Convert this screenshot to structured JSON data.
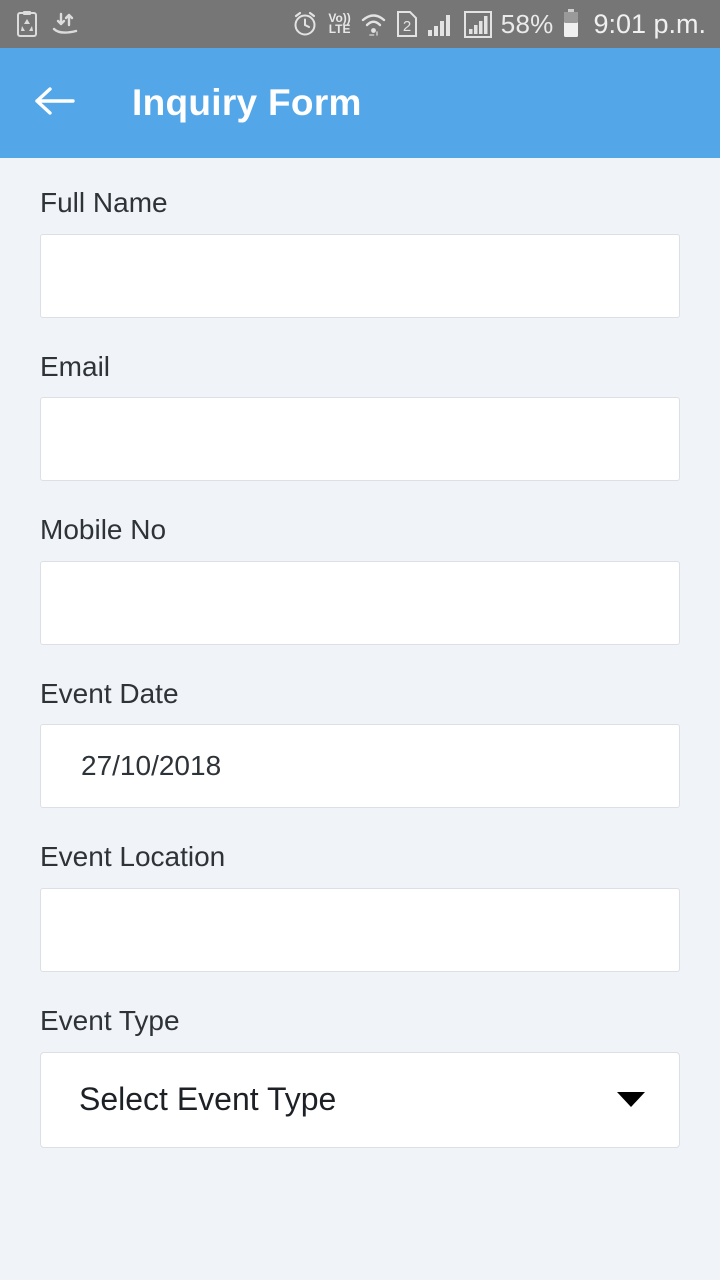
{
  "status_bar": {
    "left_icons": [
      "recycle-clipboard-icon",
      "data-transfer-icon"
    ],
    "right_icons": [
      "alarm-clock-icon",
      "volte-icon",
      "wifi-icon",
      "sim2-icon",
      "signal-bars-icon",
      "signal-bars-boxed-icon",
      "battery-icon"
    ],
    "volte_top": "Vo))",
    "volte_bottom": "LTE",
    "sim_label": "2",
    "battery_percent": "58%",
    "time": "9:01 p.m.",
    "background_color": "#767676"
  },
  "app_bar": {
    "back_label": "back-arrow",
    "title": "Inquiry Form",
    "background_color": "#53a6e8",
    "text_color": "#ffffff"
  },
  "form": {
    "fields": [
      {
        "label": "Full Name",
        "value": "",
        "placeholder": "",
        "type": "text"
      },
      {
        "label": "Email",
        "value": "",
        "placeholder": "",
        "type": "text"
      },
      {
        "label": "Mobile No",
        "value": "",
        "placeholder": "",
        "type": "text"
      },
      {
        "label": "Event Date",
        "value": "27/10/2018",
        "placeholder": "",
        "type": "date"
      },
      {
        "label": "Event Location",
        "value": "",
        "placeholder": "",
        "type": "text"
      }
    ],
    "event_type": {
      "label": "Event Type",
      "selected": "Select Event Type",
      "options": [
        "Select Event Type"
      ]
    },
    "next_field_partial_label": "",
    "background_color": "#f0f3f7",
    "input_background": "#ffffff",
    "input_border_color": "#dcdfe4",
    "label_color": "#2e3338"
  }
}
